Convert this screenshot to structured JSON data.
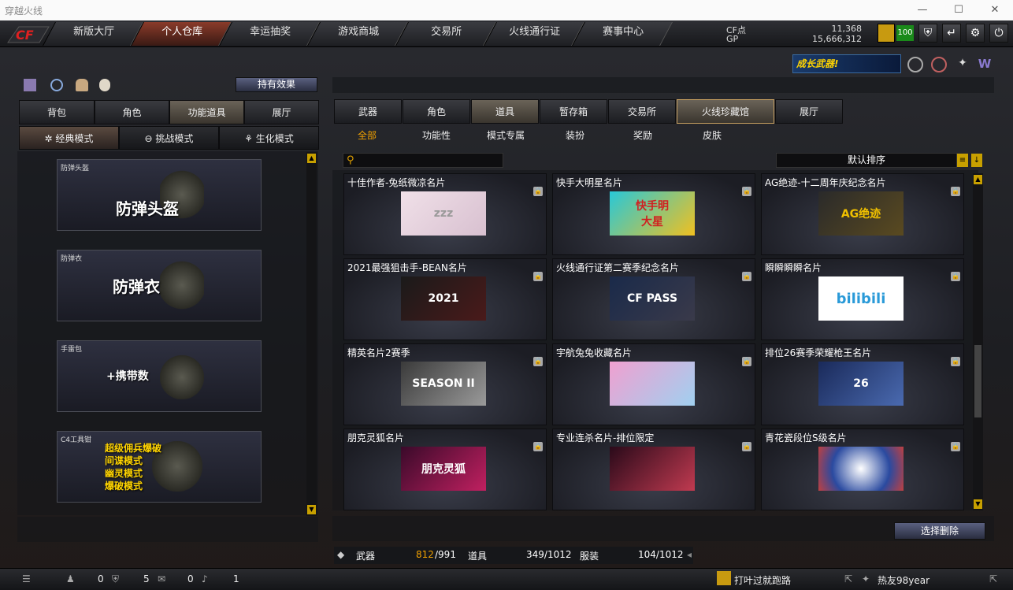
{
  "window": {
    "title": "穿越火线"
  },
  "nav": {
    "tabs": [
      "新版大厅",
      "个人仓库",
      "幸运抽奖",
      "游戏商城",
      "交易所",
      "火线通行证",
      "赛事中心"
    ],
    "active": 1
  },
  "currency": {
    "cf_label": "CF点",
    "cf_value": "11,368",
    "gp_label": "GP",
    "gp_value": "15,666,312"
  },
  "level_badge": "100",
  "banner": "成长武器!",
  "left": {
    "effect_button": "持有效果",
    "tabs": [
      "背包",
      "角色",
      "功能道具",
      "展厅"
    ],
    "modes": [
      "经典模式",
      "挑战模式",
      "生化模式"
    ],
    "items": [
      {
        "label": "防弹头盔",
        "text": "防弹头盔"
      },
      {
        "label": "防弹衣",
        "text": "防弹衣"
      },
      {
        "label": "手雷包",
        "text": "+携带数"
      },
      {
        "label": "C4工具钳",
        "lines": [
          "超级佣兵爆破",
          "间谍模式",
          "幽灵模式",
          "爆破模式"
        ]
      }
    ]
  },
  "right": {
    "tabs": [
      "武器",
      "角色",
      "道具",
      "暂存箱",
      "交易所",
      "火线珍藏馆",
      "展厅"
    ],
    "subtabs": [
      "全部",
      "功能性",
      "模式专属",
      "装扮",
      "奖励",
      "皮肤"
    ],
    "sort": "默认排序",
    "cards": [
      {
        "name": "十佳作者-兔纸微凉名片",
        "img": "zzz"
      },
      {
        "name": "快手大明星名片",
        "img": "快手明\n大星"
      },
      {
        "name": "AG绝迹-十二周年庆纪念名片",
        "img": "AG绝迹"
      },
      {
        "name": "2021最强狙击手-BEAN名片",
        "img": "2021"
      },
      {
        "name": "火线通行证第二赛季纪念名片",
        "img": "CF PASS"
      },
      {
        "name": "瞬瞬瞬瞬名片",
        "img": "bilibili"
      },
      {
        "name": "精英名片2赛季",
        "img": "SEASON II"
      },
      {
        "name": "宇航兔兔收藏名片",
        "img": ""
      },
      {
        "name": "排位26赛季荣耀枪王名片",
        "img": "26"
      },
      {
        "name": "朋克灵狐名片",
        "img": "朋克灵狐"
      },
      {
        "name": "专业连杀名片-排位限定",
        "img": ""
      },
      {
        "name": "青花瓷段位S级名片",
        "img": ""
      }
    ],
    "delete_button": "选择删除"
  },
  "stats": {
    "weapon_label": "武器",
    "weapon_used": "812",
    "weapon_total": "/991",
    "item_label": "道具",
    "item_value": "349/1012",
    "outfit_label": "服装",
    "outfit_value": "104/1012"
  },
  "bottom": {
    "c1": "0",
    "c2": "5",
    "c3": "0",
    "c4": "1",
    "news": "打叶过就跑路",
    "friend": "热友98year"
  }
}
